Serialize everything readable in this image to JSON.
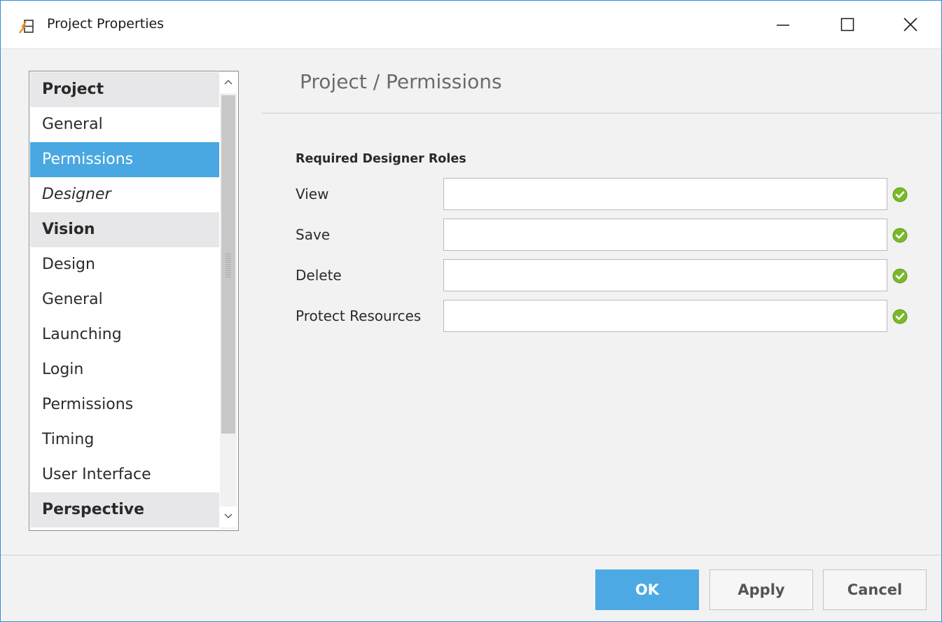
{
  "window": {
    "title": "Project Properties",
    "icon": "ignition-designer-icon",
    "controls": [
      "minimize",
      "maximize",
      "close"
    ]
  },
  "sidebar": {
    "items": [
      {
        "label": "Project",
        "type": "header"
      },
      {
        "label": "General",
        "type": "item"
      },
      {
        "label": "Permissions",
        "type": "item",
        "selected": true
      },
      {
        "label": "Designer",
        "type": "item",
        "italic": true
      },
      {
        "label": "Vision",
        "type": "header"
      },
      {
        "label": "Design",
        "type": "item"
      },
      {
        "label": "General",
        "type": "item"
      },
      {
        "label": "Launching",
        "type": "item"
      },
      {
        "label": "Login",
        "type": "item"
      },
      {
        "label": "Permissions",
        "type": "item"
      },
      {
        "label": "Timing",
        "type": "item"
      },
      {
        "label": "User Interface",
        "type": "item"
      },
      {
        "label": "Perspective",
        "type": "header"
      }
    ]
  },
  "main": {
    "title": "Project / Permissions",
    "section_heading": "Required Designer Roles",
    "fields": [
      {
        "label": "View",
        "value": "",
        "status": "valid"
      },
      {
        "label": "Save",
        "value": "",
        "status": "valid"
      },
      {
        "label": "Delete",
        "value": "",
        "status": "valid"
      },
      {
        "label": "Protect Resources",
        "value": "",
        "status": "valid"
      }
    ]
  },
  "footer": {
    "ok_label": "OK",
    "apply_label": "Apply",
    "cancel_label": "Cancel"
  },
  "colors": {
    "accent": "#49a8e2",
    "window_border": "#2f8fd8",
    "check_green": "#7ab929"
  }
}
